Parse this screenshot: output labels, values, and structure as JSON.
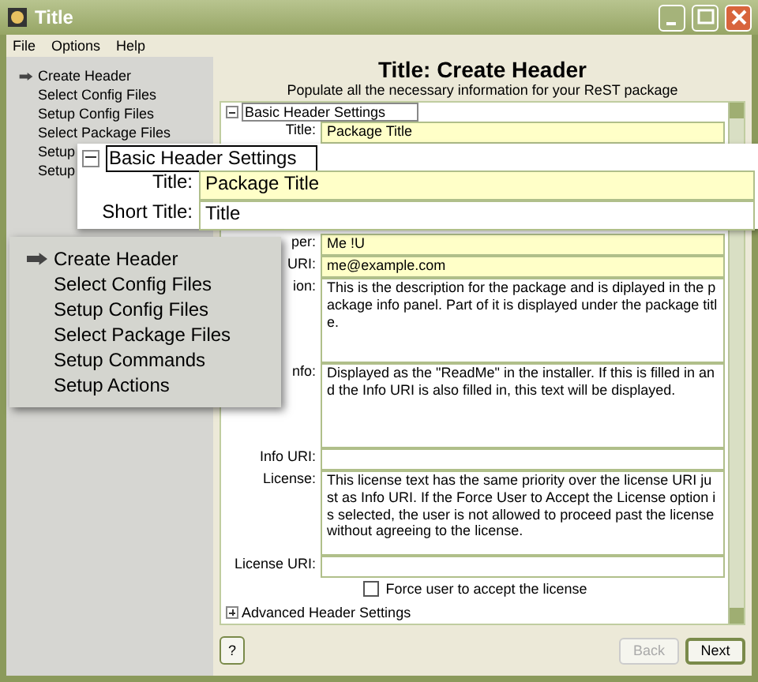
{
  "window": {
    "title": "Title"
  },
  "menu": [
    "File",
    "Options",
    "Help"
  ],
  "sidebar": {
    "items": [
      {
        "label": "Create Header",
        "selected": true
      },
      {
        "label": "Select Config Files",
        "selected": false
      },
      {
        "label": "Setup Config Files",
        "selected": false
      },
      {
        "label": "Select Package Files",
        "selected": false
      },
      {
        "label": "Setup",
        "selected": false
      },
      {
        "label": "Setup",
        "selected": false
      }
    ]
  },
  "header": {
    "title": "Title: Create Header",
    "subtitle": "Populate all the necessary information for your ReST package"
  },
  "basic_section": {
    "label": "Basic Header Settings",
    "expanded": true,
    "top_fields": [
      {
        "label": "Title:",
        "value": "Package Title",
        "required": true,
        "kind": "line"
      }
    ],
    "fields": [
      {
        "label": "per:",
        "value": "Me !U",
        "required": true,
        "kind": "line"
      },
      {
        "label": "URI:",
        "value": "me@example.com",
        "required": true,
        "kind": "line"
      },
      {
        "label": "ion:",
        "value": "This is the description for the package and is diplayed in the package info panel.  Part of it is displayed under the package title.",
        "required": false,
        "kind": "area"
      },
      {
        "label": "nfo:",
        "value": "Displayed as the \"ReadMe\" in the installer.  If this is filled in and the Info URI is also filled in, this text will be displayed.",
        "required": false,
        "kind": "area"
      },
      {
        "label": "Info URI:",
        "required": false,
        "kind": "line"
      },
      {
        "label": "License:",
        "value": "This license text has the same priority over the license URI just as Info URI.  If the Force User to Accept the License option is selected, the user is not allowed to proceed past the license without agreeing to the license.",
        "required": false,
        "kind": "area"
      },
      {
        "label": "License URI:",
        "required": false,
        "kind": "line"
      }
    ],
    "checkbox": {
      "label": "Force user to accept the license",
      "checked": false
    }
  },
  "advanced_section": {
    "label": "Advanced Header Settings",
    "expanded": false
  },
  "buttons": {
    "help": "?",
    "back": {
      "label": "Back",
      "disabled": true
    },
    "next": {
      "label": "Next",
      "disabled": false
    }
  },
  "magnifier_form": {
    "section_label": "Basic Header Settings",
    "expanded": true,
    "fields": [
      {
        "label": "Title:",
        "value": "Package Title",
        "required": true
      },
      {
        "label": "Short Title:",
        "value": "Title",
        "required": false
      }
    ]
  },
  "magnifier_menu": {
    "items": [
      {
        "label": "Create Header",
        "selected": true
      },
      {
        "label": "Select Config Files",
        "selected": false
      },
      {
        "label": "Setup Config Files",
        "selected": false
      },
      {
        "label": "Select Package Files",
        "selected": false
      },
      {
        "label": "Setup Commands",
        "selected": false
      },
      {
        "label": "Setup Actions",
        "selected": false
      }
    ]
  }
}
